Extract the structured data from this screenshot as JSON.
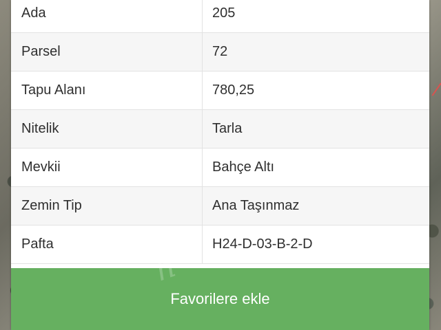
{
  "parcel_info": {
    "rows": [
      {
        "label": "Ada",
        "value": "205"
      },
      {
        "label": "Parsel",
        "value": "72"
      },
      {
        "label": "Tapu Alanı",
        "value": "780,25"
      },
      {
        "label": "Nitelik",
        "value": "Tarla"
      },
      {
        "label": "Mevkii",
        "value": "Bahçe Altı"
      },
      {
        "label": "Zemin Tip",
        "value": "Ana Taşınmaz"
      },
      {
        "label": "Pafta",
        "value": "H24-D-03-B-2-D"
      }
    ]
  },
  "actions": {
    "favorite_label": "Favorilere ekle"
  },
  "colors": {
    "button_green": "#66b060",
    "row_alt": "#f6f6f6",
    "border": "#e2e2e2"
  }
}
